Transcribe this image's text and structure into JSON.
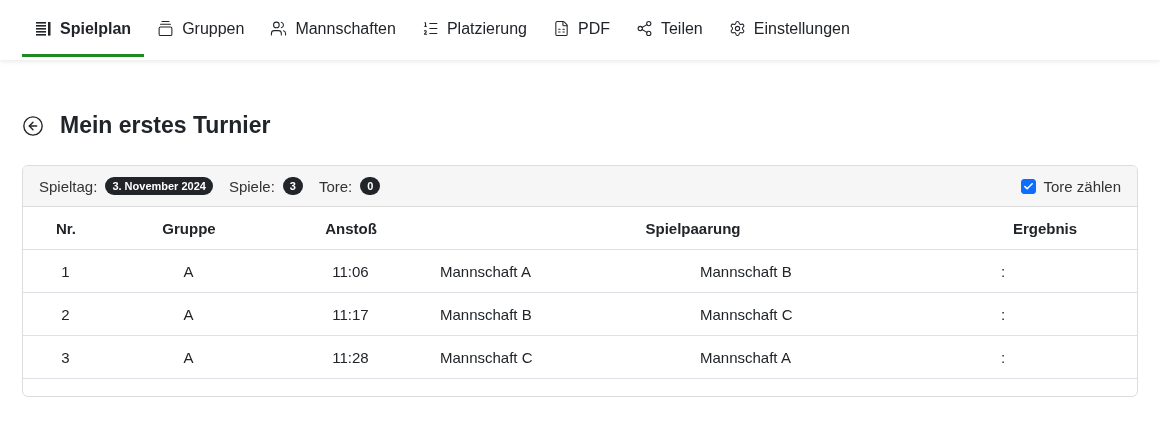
{
  "tabs": [
    {
      "label": "Spielplan",
      "selected": true
    },
    {
      "label": "Gruppen",
      "selected": false
    },
    {
      "label": "Mannschaften",
      "selected": false
    },
    {
      "label": "Platzierung",
      "selected": false
    },
    {
      "label": "PDF",
      "selected": false
    },
    {
      "label": "Teilen",
      "selected": false
    },
    {
      "label": "Einstellungen",
      "selected": false
    }
  ],
  "title": "Mein erstes Turnier",
  "summary": {
    "matchday_label": "Spieltag:",
    "matchday": "3. November 2024",
    "games_label": "Spiele:",
    "games": "3",
    "goals_label": "Tore:",
    "goals": "0",
    "count_goals": {
      "label": "Tore zählen",
      "checked": true
    }
  },
  "table": {
    "columns": [
      "Nr.",
      "Gruppe",
      "Anstoß",
      "Spielpaarung",
      "Ergebnis"
    ],
    "rows": [
      {
        "nr": "1",
        "group": "A",
        "kickoff": "11:06",
        "home": "Mannschaft A",
        "away": "Mannschaft B",
        "result": ":"
      },
      {
        "nr": "2",
        "group": "A",
        "kickoff": "11:17",
        "home": "Mannschaft B",
        "away": "Mannschaft C",
        "result": ":"
      },
      {
        "nr": "3",
        "group": "A",
        "kickoff": "11:28",
        "home": "Mannschaft C",
        "away": "Mannschaft A",
        "result": ":"
      }
    ]
  }
}
